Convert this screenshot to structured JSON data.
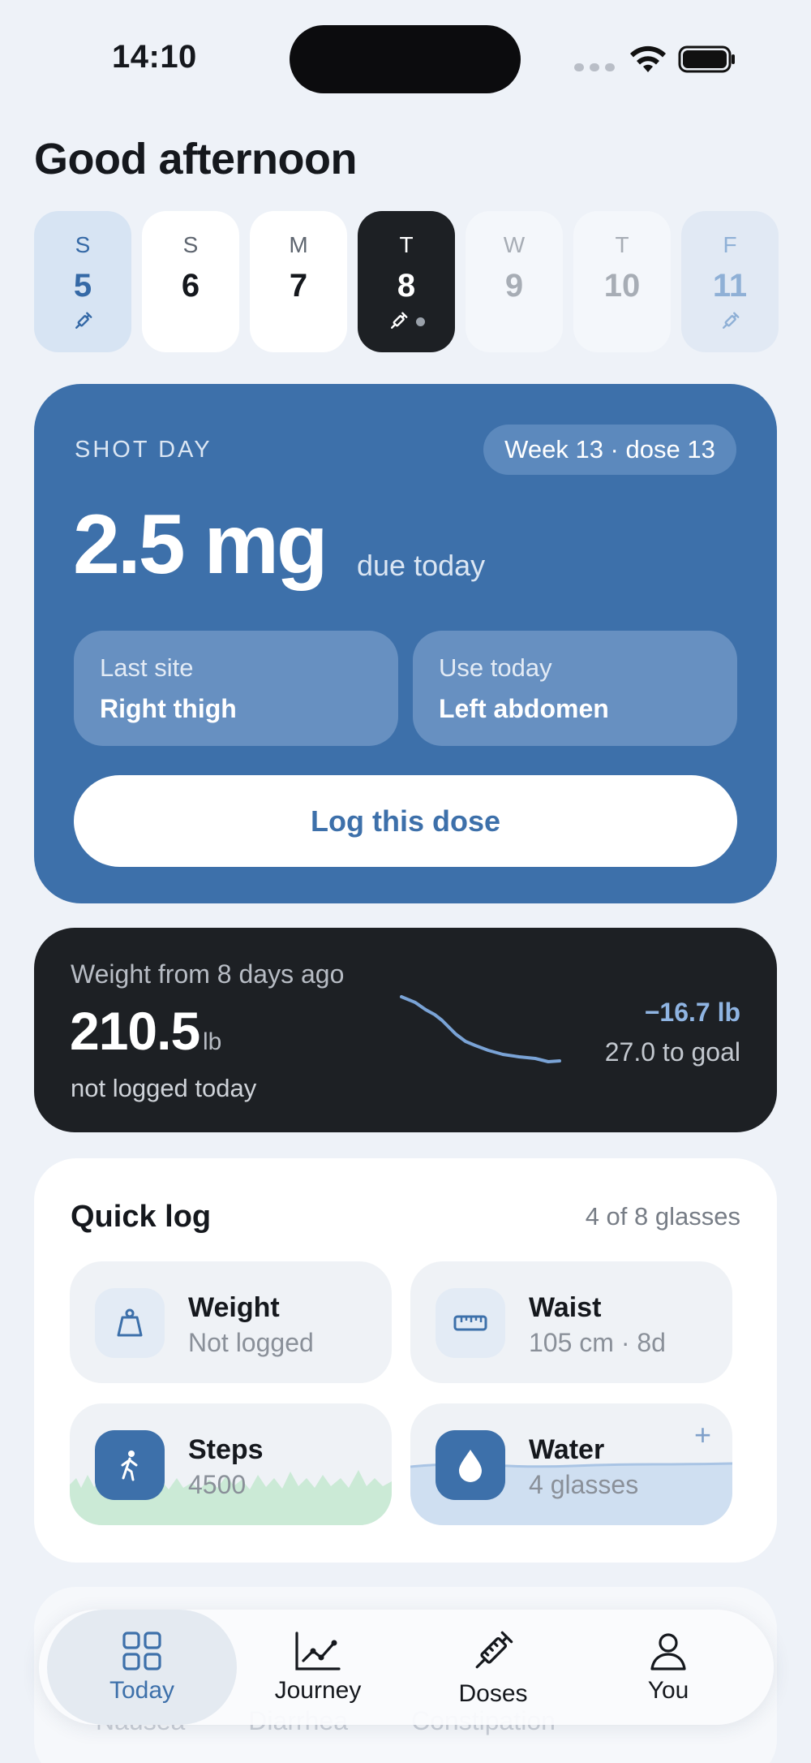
{
  "status_bar": {
    "time": "14:10"
  },
  "greeting": "Good afternoon",
  "days": [
    {
      "dow": "S",
      "date": "5",
      "state": "past",
      "shot": true
    },
    {
      "dow": "S",
      "date": "6",
      "state": "normal",
      "shot": false
    },
    {
      "dow": "M",
      "date": "7",
      "state": "normal",
      "shot": false
    },
    {
      "dow": "T",
      "date": "8",
      "state": "active",
      "shot": true
    },
    {
      "dow": "W",
      "date": "9",
      "state": "future",
      "shot": false
    },
    {
      "dow": "T",
      "date": "10",
      "state": "future",
      "shot": false
    },
    {
      "dow": "F",
      "date": "11",
      "state": "future-blue",
      "shot": true
    }
  ],
  "shot": {
    "label": "SHOT DAY",
    "week_pill": "Week 13 · dose 13",
    "dose": "2.5 mg",
    "due": "due today",
    "last_site_label": "Last site",
    "last_site_value": "Right thigh",
    "use_today_label": "Use today",
    "use_today_value": "Left abdomen",
    "log_button": "Log this dose",
    "accent": "#3d70aa"
  },
  "weight": {
    "subtitle": "Weight from 8 days ago",
    "value": "210.5",
    "unit": "lb",
    "status": "not logged today",
    "delta": "−16.7 lb",
    "to_goal": "27.0 to goal"
  },
  "quick_log": {
    "title": "Quick log",
    "summary": "4 of 8 glasses",
    "tiles": {
      "weight": {
        "title": "Weight",
        "sub": "Not logged",
        "icon": "scale-icon"
      },
      "waist": {
        "title": "Waist",
        "sub": "105 cm · 8d",
        "icon": "ruler-icon"
      },
      "steps": {
        "title": "Steps",
        "sub": "4500",
        "icon": "walking-icon"
      },
      "water": {
        "title": "Water",
        "sub": "4 glasses",
        "icon": "water-drop-icon",
        "plus": "+"
      }
    }
  },
  "peek": {
    "tags": [
      "Nausea",
      "Diarrhea",
      "Constipation"
    ]
  },
  "tabs": [
    {
      "label": "Today",
      "icon": "grid-icon",
      "selected": true
    },
    {
      "label": "Journey",
      "icon": "chart-line-icon",
      "selected": false
    },
    {
      "label": "Doses",
      "icon": "syringe-icon",
      "selected": false
    },
    {
      "label": "You",
      "icon": "person-icon",
      "selected": false
    }
  ]
}
